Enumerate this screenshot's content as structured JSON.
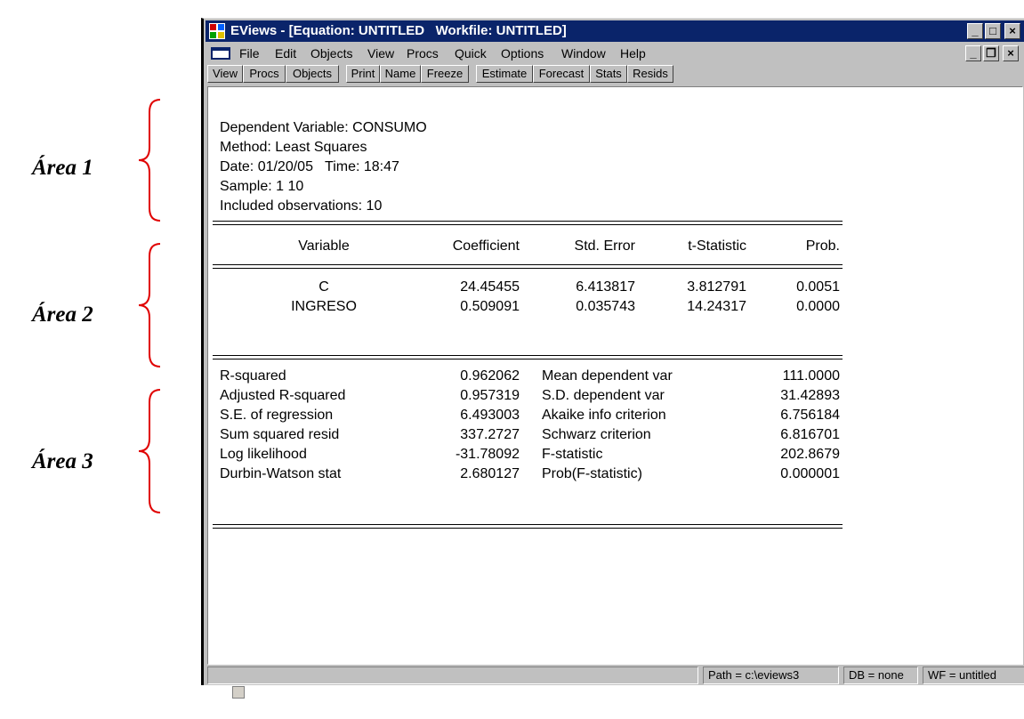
{
  "annotations": {
    "area1": "Área 1",
    "area2": "Área 2",
    "area3": "Área 3"
  },
  "window": {
    "title": "EViews - [Equation: UNTITLED   Workfile: UNTITLED]",
    "title_bar_color": "#0a246a"
  },
  "menu": [
    "File",
    "Edit",
    "Objects",
    "View",
    "Procs",
    "Quick",
    "Options",
    "Window",
    "Help"
  ],
  "toolbar": [
    "View",
    "Procs",
    "Objects",
    "Print",
    "Name",
    "Freeze",
    "Estimate",
    "Forecast",
    "Stats",
    "Resids"
  ],
  "header": {
    "dependent": "Dependent Variable: CONSUMO",
    "method": "Method: Least Squares",
    "date": "Date: 01/20/05   Time: 18:47",
    "sample": "Sample: 1 10",
    "included": "Included observations: 10"
  },
  "table": {
    "columns": [
      "Variable",
      "Coefficient",
      "Std. Error",
      "t-Statistic",
      "Prob."
    ],
    "rows": [
      [
        "C",
        "24.45455",
        "6.413817",
        "3.812791",
        "0.0051"
      ],
      [
        "INGRESO",
        "0.509091",
        "0.035743",
        "14.24317",
        "0.0000"
      ]
    ]
  },
  "stats": [
    [
      "R-squared",
      "0.962062",
      "Mean dependent var",
      "111.0000"
    ],
    [
      "Adjusted R-squared",
      "0.957319",
      "S.D. dependent var",
      "31.42893"
    ],
    [
      "S.E. of regression",
      "6.493003",
      "Akaike info criterion",
      "6.756184"
    ],
    [
      "Sum squared resid",
      "337.2727",
      "Schwarz criterion",
      "6.816701"
    ],
    [
      "Log likelihood",
      "-31.78092",
      "F-statistic",
      "202.8679"
    ],
    [
      "Durbin-Watson stat",
      "2.680127",
      "Prob(F-statistic)",
      "0.000001"
    ]
  ],
  "status": {
    "path": "Path = c:\\eviews3",
    "db": "DB = none",
    "wf": "WF = untitled"
  }
}
